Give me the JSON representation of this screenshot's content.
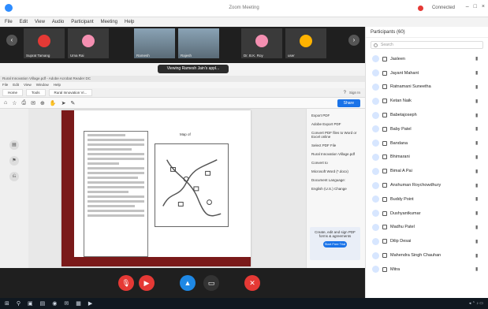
{
  "window": {
    "title": "Zoom Meeting",
    "connected": "Connected"
  },
  "menubar": [
    "File",
    "Edit",
    "View",
    "Audio",
    "Participant",
    "Meeting",
    "Help"
  ],
  "video_strip": {
    "tiles": [
      {
        "name": "Suprat Tamang",
        "color": "#e53935",
        "video": false
      },
      {
        "name": "Uma Rai",
        "color": "#f48fb1",
        "video": false
      },
      {
        "name": "Ramesh",
        "color": "#000000",
        "video": true
      },
      {
        "name": "Rajesh",
        "color": "#000000",
        "video": true
      },
      {
        "name": "Dr. B.K. Roy",
        "color": "#f48fb1",
        "video": false
      },
      {
        "name": "user",
        "color": "#ffb300",
        "video": false
      }
    ],
    "banner": "Viewing Ramesh Jain's appl..."
  },
  "browser": {
    "title": "Rural Innovation Village.pdf - Adobe Acrobat Reader DC",
    "menu": [
      "File",
      "Edit",
      "View",
      "Window",
      "Help"
    ],
    "tabs": [
      "Home",
      "Tools",
      "Rural Innovation Vi..."
    ],
    "signin": "Sign In",
    "share": "Share",
    "right_panel": {
      "items": [
        "Export PDF",
        "Adobe Export PDF",
        "Convert PDF files to Word or Excel online",
        "Select PDF File",
        "Rural Innovation Village.pdf",
        "Convert to",
        "Microsoft Word (*.docx)",
        "Document Language:",
        "English (U.S.) Change"
      ],
      "promo": "Create, edit and sign PDF forms & agreements",
      "promo_btn": "Start Free Trial"
    },
    "pdf": {
      "map_title": "Map of"
    }
  },
  "participants": {
    "header": "Participants (60)",
    "search": "Search",
    "list": [
      "Jasleen",
      "Jayant Mahant",
      "Ratnamani Suneetha",
      "Ketan Naik",
      "Babetajoseph",
      "Baby Patel",
      "Bandana",
      "Bhimarani",
      "Bimal A Pai",
      "Anshuman Roychowdhury",
      "Buddy Point",
      "Dushyantkumar",
      "Madhu Patel",
      "Dilip Desai",
      "Mahendra Singh Chauhan",
      "Mitra"
    ]
  }
}
